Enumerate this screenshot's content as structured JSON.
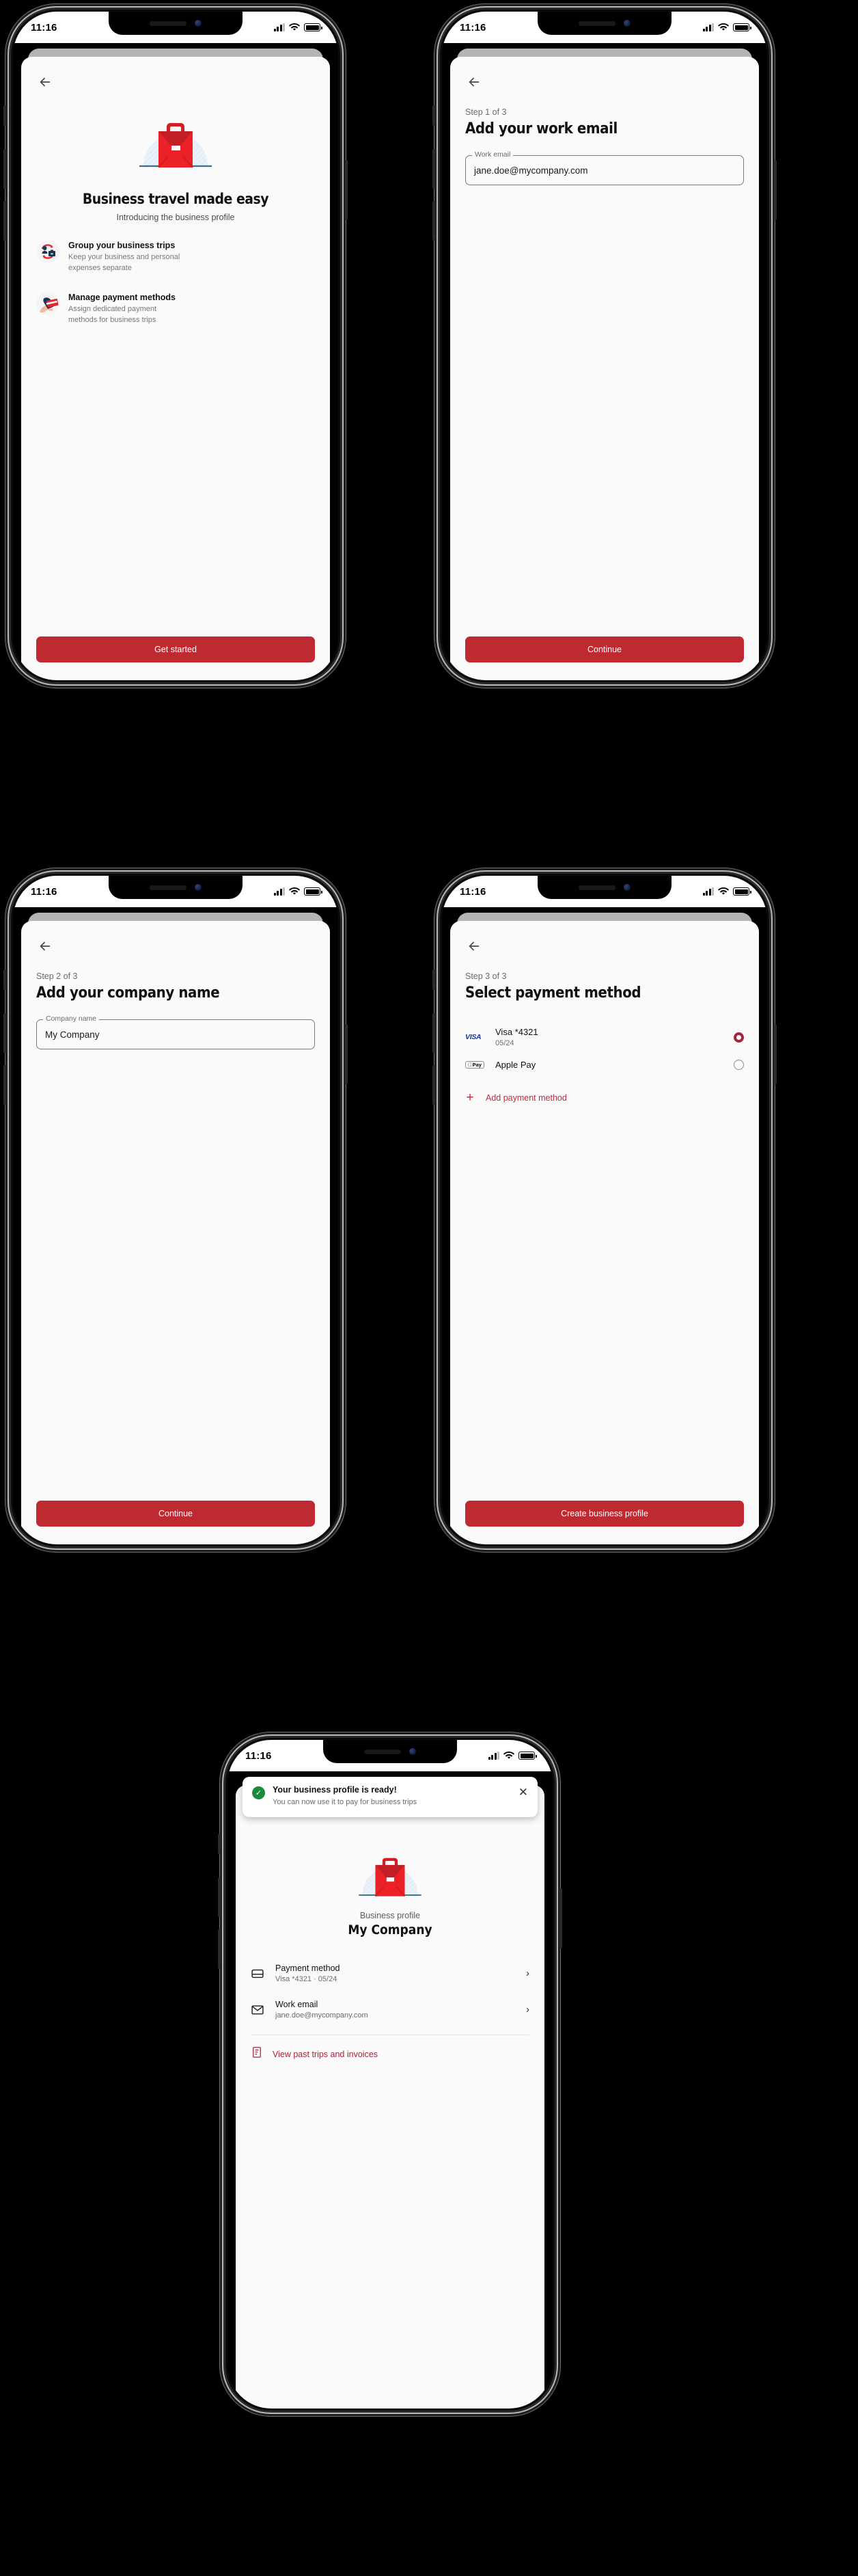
{
  "status_bar": {
    "time": "11:16",
    "signal_icon": "cellular-bars-icon",
    "wifi_icon": "wifi-icon",
    "battery_icon": "battery-icon"
  },
  "colors": {
    "brand_red": "#bf2a32",
    "link_red": "#a3263a",
    "success_green": "#1b8a3a",
    "visa_blue": "#1a32a0"
  },
  "screens": {
    "intro": {
      "back_icon": "back-arrow-icon",
      "hero_icon": "briefcase-illustration",
      "title": "Business travel made easy",
      "subtitle": "Introducing the business profile",
      "features": [
        {
          "icon": "group-trips-icon",
          "title": "Group your business trips",
          "subtitle": "Keep your business and personal expenses separate"
        },
        {
          "icon": "payment-card-hand-icon",
          "title": "Manage payment methods",
          "subtitle": "Assign dedicated payment methods for business trips"
        }
      ],
      "cta": "Get started"
    },
    "step1": {
      "back_icon": "back-arrow-icon",
      "step": "Step 1 of 3",
      "title": "Add your work email",
      "field": {
        "label": "Work email",
        "value": "jane.doe@mycompany.com",
        "placeholder": "Work email"
      },
      "cta": "Continue"
    },
    "step2": {
      "back_icon": "back-arrow-icon",
      "step": "Step 2 of 3",
      "title": "Add your company name",
      "field": {
        "label": "Company name",
        "value": "My Company",
        "placeholder": "Company name"
      },
      "cta": "Continue"
    },
    "step3": {
      "back_icon": "back-arrow-icon",
      "step": "Step 3 of 3",
      "title": "Select payment method",
      "methods": [
        {
          "logo": "visa-logo-icon",
          "logo_text": "VISA",
          "name": "Visa *4321",
          "expiry": "05/24",
          "selected": true
        },
        {
          "logo": "apple-pay-logo-icon",
          "logo_text": "Pay",
          "name": "Apple Pay",
          "expiry": "",
          "selected": false
        }
      ],
      "add_method": {
        "icon": "plus-icon",
        "label": "Add payment method"
      },
      "cta": "Create business profile"
    },
    "success": {
      "toast": {
        "icon": "success-check-icon",
        "title": "Your business profile is ready!",
        "subtitle": "You can now use it to pay for business trips",
        "close_icon": "close-icon"
      },
      "hero_icon": "briefcase-illustration",
      "kicker": "Business profile",
      "name": "My Company",
      "rows": [
        {
          "icon": "credit-card-icon",
          "title": "Payment method",
          "subtitle": "Visa *4321 · 05/24",
          "chevron": "chevron-right-icon"
        },
        {
          "icon": "envelope-icon",
          "title": "Work email",
          "subtitle": "jane.doe@mycompany.com",
          "chevron": "chevron-right-icon"
        }
      ],
      "link": {
        "icon": "invoice-document-icon",
        "label": "View past trips and invoices"
      }
    }
  }
}
